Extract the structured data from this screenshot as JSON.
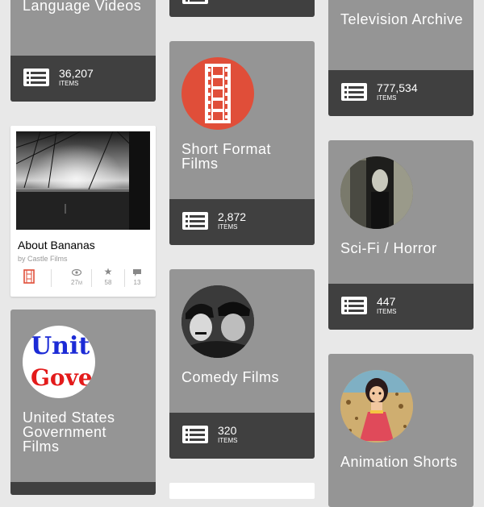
{
  "column1": {
    "language_tile": {
      "title": "Language Videos",
      "count": "36,207",
      "unit": "ITEMS"
    },
    "item_card": {
      "title": "About Bananas",
      "byline": "by Castle Films",
      "views": "27",
      "views_suffix": "M",
      "favorites": "58",
      "reviews": "13"
    },
    "usgov_tile": {
      "title": "United States Government Films",
      "logo_text_1": "Unit",
      "logo_text_2": "Gove"
    }
  },
  "column2": {
    "short_tile": {
      "title": "Short Format Films",
      "count": "2,872",
      "unit": "ITEMS"
    },
    "comedy_tile": {
      "title": "Comedy Films",
      "count": "320",
      "unit": "ITEMS"
    }
  },
  "column3": {
    "tv_tile": {
      "title": "Television Archive",
      "count": "777,534",
      "unit": "ITEMS"
    },
    "scifi_tile": {
      "title": "Sci-Fi / Horror",
      "count": "447",
      "unit": "ITEMS"
    },
    "anim_tile": {
      "title": "Animation Shorts"
    }
  },
  "colors": {
    "tile_bg": "#959595",
    "footer_bg": "#404040",
    "film_icon_bg": "#e04e39",
    "page_bg": "#e8e8e8"
  },
  "icons": [
    "list-icon",
    "film-strip-icon",
    "eye-icon",
    "star-icon",
    "comment-icon"
  ]
}
